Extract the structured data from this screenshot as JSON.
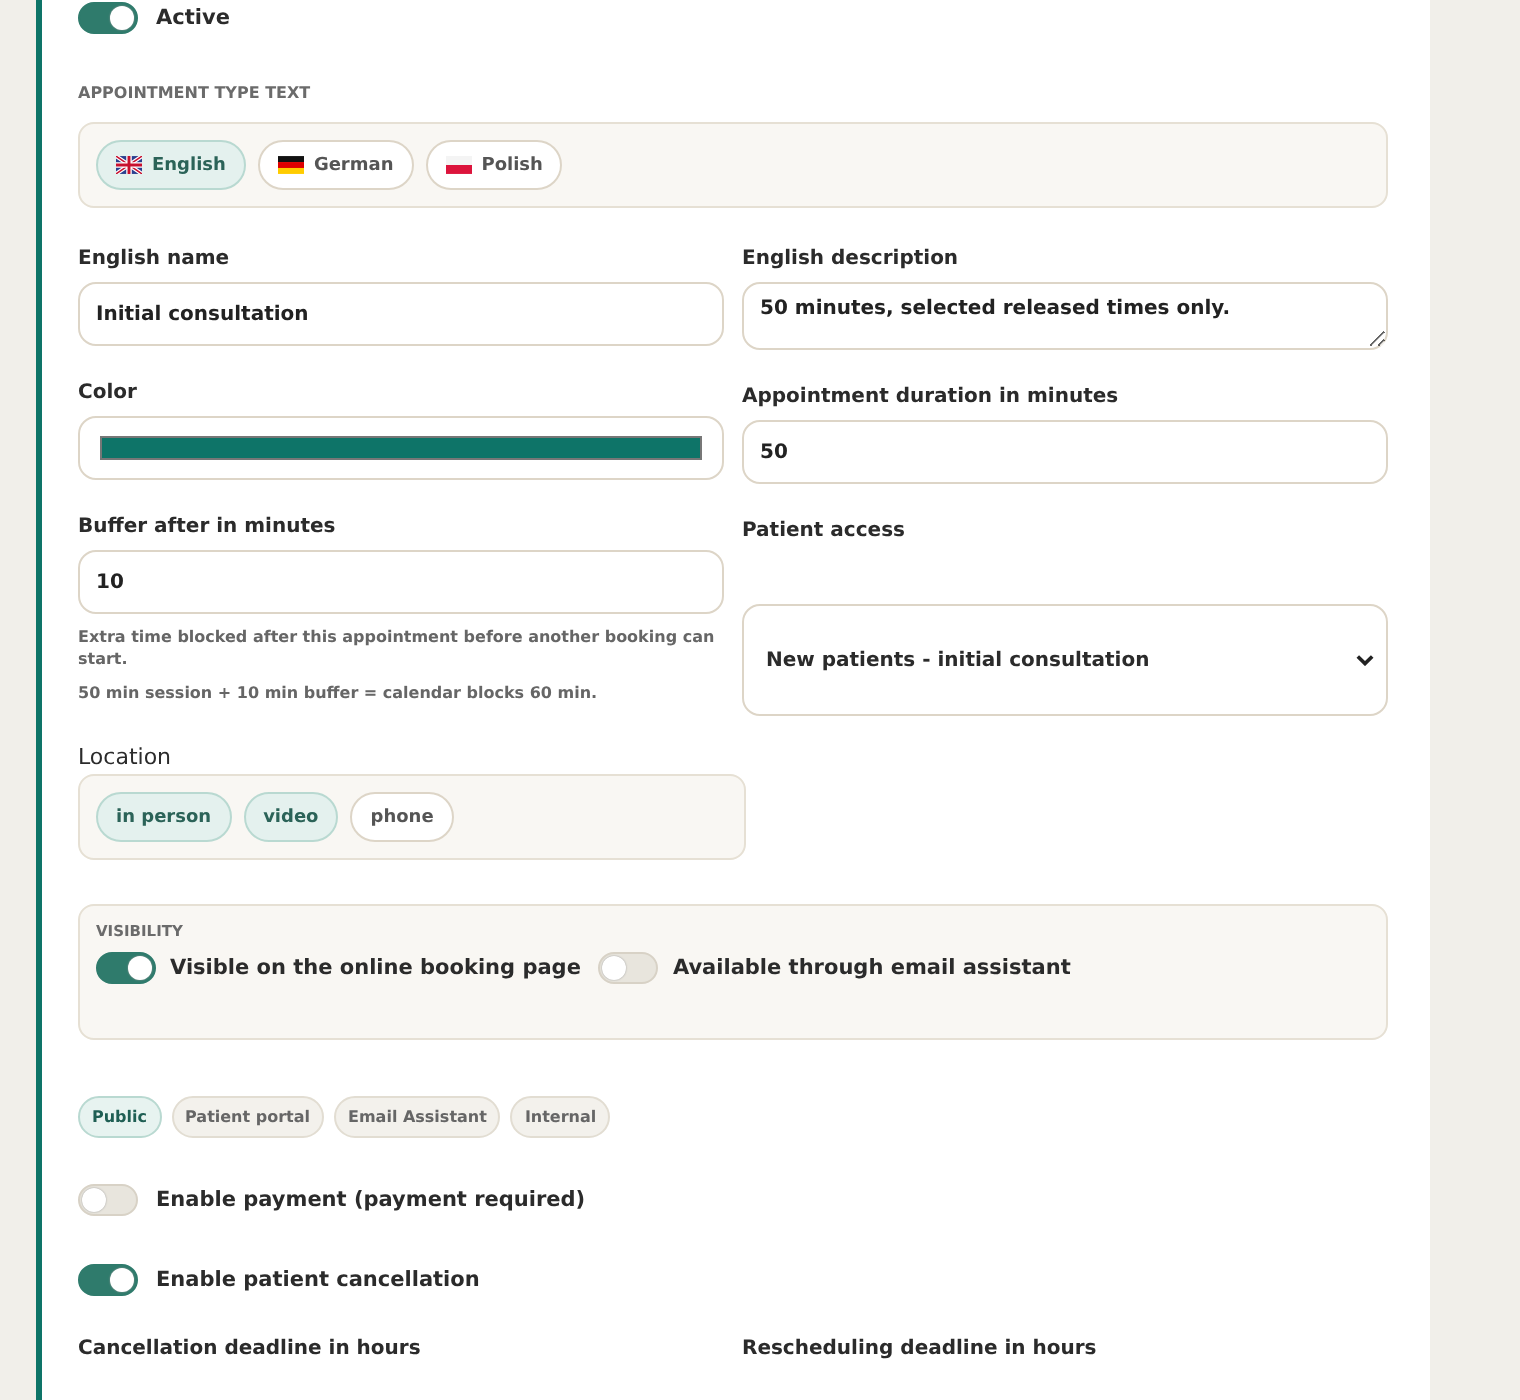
{
  "active_toggle": {
    "label": "Active",
    "on": true
  },
  "text_section": {
    "heading": "APPOINTMENT TYPE TEXT",
    "languages": [
      {
        "label": "English",
        "kind": "gb",
        "selected": true
      },
      {
        "label": "German",
        "kind": "de",
        "selected": false
      },
      {
        "label": "Polish",
        "kind": "pl",
        "selected": false
      }
    ]
  },
  "name_field": {
    "label": "English name",
    "value": "Initial consultation"
  },
  "description_field": {
    "label": "English description",
    "value": "50 minutes, selected released times only."
  },
  "color_field": {
    "label": "Color",
    "color": "#0e7468"
  },
  "duration_field": {
    "label": "Appointment duration in minutes",
    "value": "50"
  },
  "buffer_field": {
    "label": "Buffer after in minutes",
    "value": "10",
    "hints": [
      "Extra time blocked after this appointment before another booking can start.",
      "50 min session + 10 min buffer = calendar blocks 60 min."
    ]
  },
  "patient_access": {
    "label": "Patient access",
    "value": "New patients - initial consultation"
  },
  "location": {
    "label": "Location",
    "options": [
      {
        "label": "in person",
        "selected": true
      },
      {
        "label": "video",
        "selected": true
      },
      {
        "label": "phone",
        "selected": false
      }
    ]
  },
  "visibility": {
    "heading": "VISIBILITY",
    "toggles": [
      {
        "label": "Visible on the online booking page",
        "on": true
      },
      {
        "label": "Available through email assistant",
        "on": false
      }
    ]
  },
  "channels": [
    {
      "label": "Public",
      "selected": true
    },
    {
      "label": "Patient portal",
      "selected": false
    },
    {
      "label": "Email Assistant",
      "selected": false
    },
    {
      "label": "Internal",
      "selected": false
    }
  ],
  "payment_toggle": {
    "label": "Enable payment (payment required)",
    "on": false
  },
  "cancellation_toggle": {
    "label": "Enable patient cancellation",
    "on": true
  },
  "deadlines": [
    {
      "label": "Cancellation deadline in hours"
    },
    {
      "label": "Rescheduling deadline in hours"
    }
  ]
}
